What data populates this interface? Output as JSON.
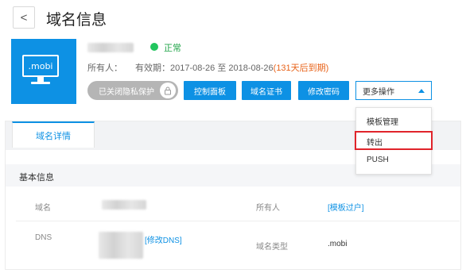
{
  "header": {
    "back_glyph": "<",
    "title": "域名信息"
  },
  "domain": {
    "tile_label": ".mobi",
    "status": "正常",
    "owner_label": "所有人：",
    "validity": "有效期：2017-08-26 至 2018-08-26",
    "validity_note": "(131天后到期)"
  },
  "actions": {
    "privacy_toggle": "已关闭隐私保护",
    "control_panel": "控制面板",
    "certificate": "域名证书",
    "change_password": "修改密码",
    "more": "更多操作"
  },
  "more_menu": {
    "items": [
      "模板管理",
      "转出",
      "PUSH"
    ],
    "highlighted": "转出"
  },
  "tabs": {
    "active": "域名详情"
  },
  "details": {
    "section_title": "基本信息",
    "domain_label": "域名",
    "owner_label": "所有人",
    "owner_link": "[模板过户]",
    "dns_label": "DNS",
    "dns_link": "[修改DNS]",
    "type_label": "域名类型",
    "type_value": ".mobi"
  },
  "colors": {
    "accent": "#0d91e4",
    "status_ok": "#22c55e",
    "warning": "#e8631a",
    "highlight_box": "#e0242b"
  }
}
